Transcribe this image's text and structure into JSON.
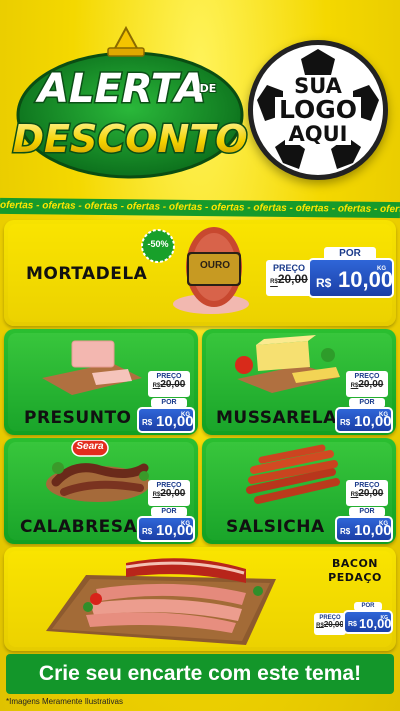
{
  "header": {
    "alert_word": "ALERTA",
    "de_word": "DE",
    "desconto_word": "DESCONTO",
    "logo_lines": [
      "SUA",
      "LOGO",
      "AQUI"
    ]
  },
  "ticker": {
    "text": "ofertas - ofertas - ofertas - ofertas - ofertas - ofertas - ofertas - ofertas - ofertas - ofertas"
  },
  "products": [
    {
      "name": "MORTADELA",
      "discount": "-50%",
      "brand": "OURO",
      "preco_label": "PREÇO",
      "old_price": "20,00",
      "por_label": "POR",
      "currency": "R$",
      "price": "10,00",
      "unit": "KG"
    },
    {
      "name": "PRESUNTO",
      "preco_label": "PREÇO",
      "old_price": "20,00",
      "por_label": "POR",
      "currency": "R$",
      "price": "10,00",
      "unit": "KG"
    },
    {
      "name": "MUSSARELA",
      "preco_label": "PREÇO",
      "old_price": "20,00",
      "por_label": "POR",
      "currency": "R$",
      "price": "10,00",
      "unit": "KG"
    },
    {
      "name": "CALABRESA",
      "brand": "Seara",
      "preco_label": "PREÇO",
      "old_price": "20,00",
      "por_label": "POR",
      "currency": "R$",
      "price": "10,00",
      "unit": "KG"
    },
    {
      "name": "SALSICHA",
      "preco_label": "PREÇO",
      "old_price": "20,00",
      "por_label": "POR",
      "currency": "R$",
      "price": "10,00",
      "unit": "KG"
    },
    {
      "name_line1": "BACON",
      "name_line2": "PEDAÇO",
      "preco_label": "PREÇO",
      "old_price": "20,00",
      "por_label": "POR",
      "currency": "R$",
      "price": "10,00",
      "unit": "KG"
    }
  ],
  "old_currency": "R$",
  "footer": {
    "cta": "Crie seu encarte com este tema!",
    "disclaimer": "*Imagens Meramente Ilustrativas"
  },
  "colors": {
    "yellow": "#f4d800",
    "green": "#1aa52a",
    "blue": "#1b3fa6",
    "red": "#d42020"
  }
}
